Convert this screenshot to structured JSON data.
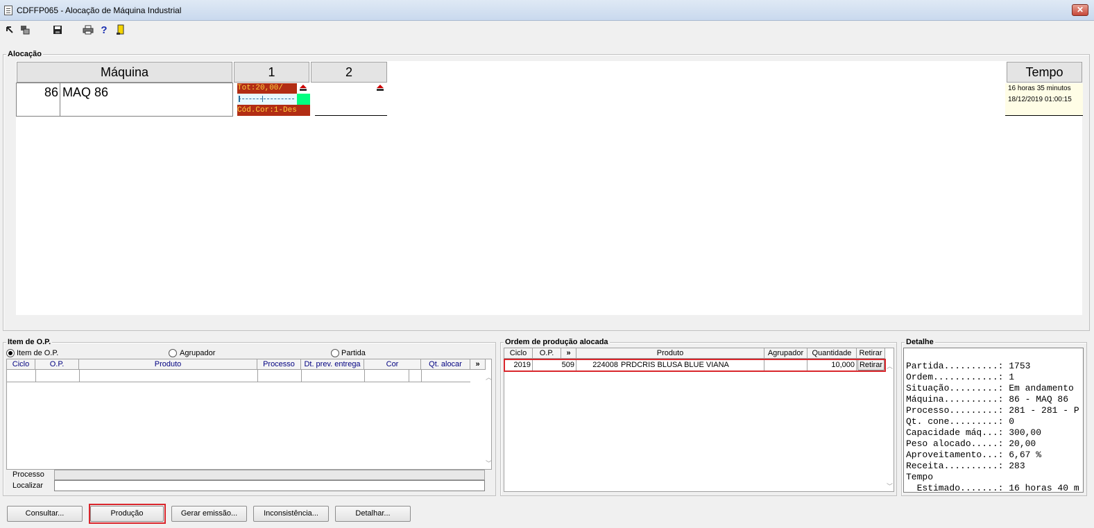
{
  "window": {
    "title": "CDFFP065 - Alocação de Máquina Industrial",
    "close": "✕"
  },
  "alocacao": {
    "label": "Alocação",
    "headers": {
      "maquina": "Máquina",
      "col1": "1",
      "col2": "2",
      "tempo": "Tempo"
    },
    "machine": {
      "code": "86",
      "name": "MAQ 86"
    },
    "slot1": {
      "line1": "Tot:20,00/",
      "line2": "Cód.Cor:1-Des"
    },
    "tempo": {
      "duration": "16 horas 35 minutos",
      "datetime": "18/12/2019 01:00:15"
    }
  },
  "item_op": {
    "label": "Item de O.P.",
    "radios": [
      {
        "label": "Item de O.P.",
        "checked": true
      },
      {
        "label": "Agrupador",
        "checked": false
      },
      {
        "label": "Partida",
        "checked": false
      }
    ],
    "columns": [
      "Ciclo",
      "O.P.",
      "Produto",
      "Processo",
      "Dt. prev. entrega",
      "Cor",
      "Qt. alocar",
      "»"
    ],
    "processo_label": "Processo",
    "localizar_label": "Localizar"
  },
  "ordem_producao": {
    "label": "Ordem de produção alocada",
    "columns": [
      "Ciclo",
      "O.P.",
      "»",
      "Produto",
      "Agrupador",
      "Quantidade",
      "Retirar"
    ],
    "row": {
      "ciclo": "2019",
      "op": "509",
      "code": "224008",
      "produto": "PRDCRIS BLUSA BLUE VIANA",
      "agrupador": "",
      "quantidade": "10,000",
      "retirar": "Retirar"
    }
  },
  "detalhe": {
    "label": "Detalhe",
    "lines": [
      "Partida..........: 1753",
      "Ordem............: 1",
      "Situação.........: Em andamento",
      "Máquina..........: 86 - MAQ 86",
      "Processo.........: 281 - 281 - P",
      "Qt. cone.........: 0",
      "Capacidade máq...: 300,00",
      "Peso alocado.....: 20,00",
      "Aproveitamento...: 6,67 %",
      "Receita..........: 283",
      "Tempo",
      "  Estimado.......: 16 horas 40 m"
    ]
  },
  "buttons": {
    "consultar": "Consultar...",
    "producao": "Produção",
    "gerar": "Gerar emissão...",
    "inconsistencia": "Inconsistência...",
    "detalhar": "Detalhar..."
  },
  "colors": {
    "slot_red": "#b22d14",
    "slot_text": "#ffd040",
    "slot_green": "#00ff80",
    "tempo_bg": "#fffde6",
    "highlight": "#d9262c"
  }
}
